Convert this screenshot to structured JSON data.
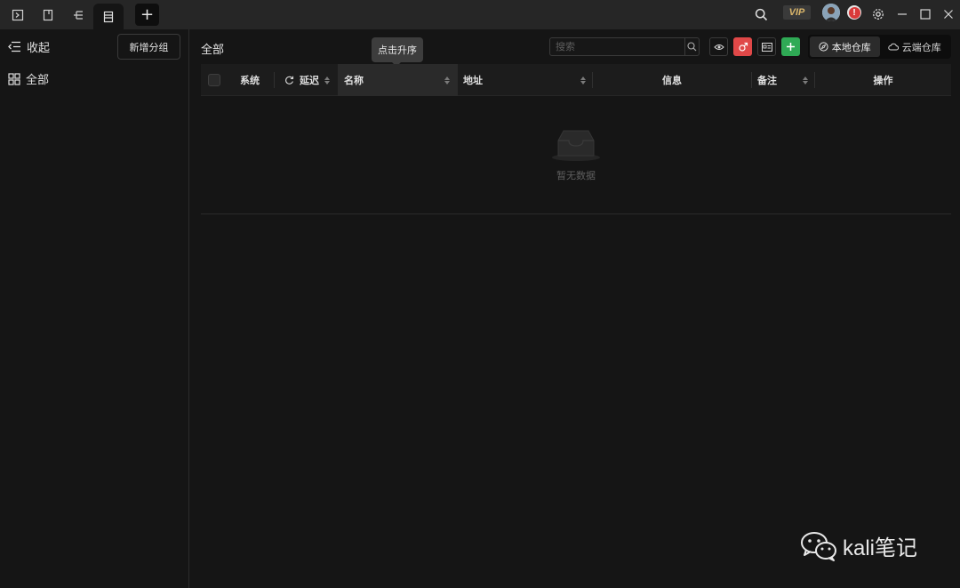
{
  "topbar": {
    "tabs": [
      {
        "icon": "terminal-icon"
      },
      {
        "icon": "document-icon"
      },
      {
        "icon": "tree-icon"
      },
      {
        "icon": "list-icon",
        "active": true
      }
    ],
    "add_tab_label": "+",
    "vip_label": "VIP",
    "alert_label": "!",
    "right_icons": [
      "search-icon",
      "vip-badge",
      "avatar",
      "alert-icon",
      "settings-icon",
      "minimize-icon",
      "maximize-icon",
      "close-icon"
    ]
  },
  "sidebar": {
    "collapse_label": "收起",
    "new_group_label": "新增分组",
    "items": [
      {
        "label": "全部",
        "icon": "grid-icon"
      }
    ]
  },
  "main": {
    "title": "全部",
    "search_placeholder": "搜索",
    "tooltip": "点击升序",
    "segments": [
      {
        "label": "本地仓库",
        "icon": "compass-icon",
        "active": true
      },
      {
        "label": "云端仓库",
        "icon": "cloud-icon",
        "active": false
      }
    ],
    "tool_buttons": [
      {
        "icon": "eye-icon",
        "color": "#151515"
      },
      {
        "icon": "male-icon",
        "color": "#e04848"
      },
      {
        "icon": "id-card-icon",
        "color": "#151515"
      },
      {
        "icon": "plus-icon",
        "color": "#2faa55"
      }
    ]
  },
  "table": {
    "columns": {
      "system": "系统",
      "latency": "延迟",
      "name": "名称",
      "address": "地址",
      "info": "信息",
      "note": "备注",
      "action": "操作"
    },
    "rows": [],
    "empty_text": "暂无数据"
  },
  "watermark": {
    "text": "kali笔记"
  },
  "colors": {
    "background": "#151515",
    "topbar": "#262626",
    "accent_red": "#e04848",
    "accent_green": "#2faa55",
    "vip_gold": "#d9b56a"
  }
}
